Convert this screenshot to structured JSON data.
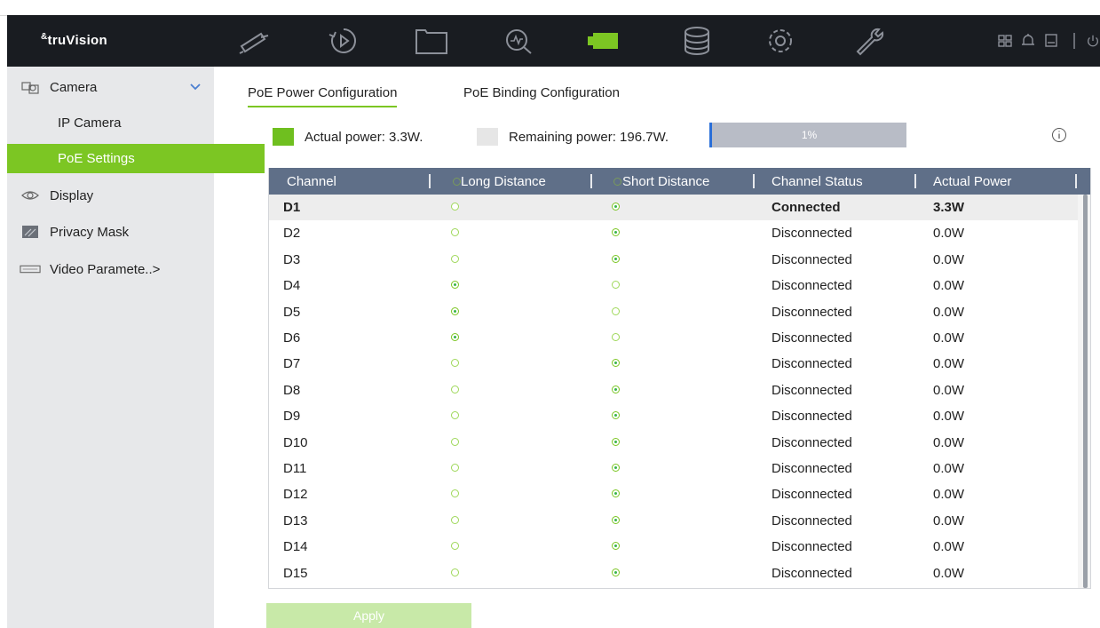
{
  "app": {
    "logo": "truVision",
    "logo_mark": "&"
  },
  "colors": {
    "accent": "#7cc623",
    "header_bg": "#191c21",
    "table_header": "#5f6f88"
  },
  "header": {
    "nav_icons": [
      "camera-icon",
      "playback-icon",
      "folder-icon",
      "search-event-icon",
      "video-camera-icon",
      "storage-icon",
      "settings-icon",
      "maintenance-icon"
    ],
    "active_nav": "video-camera-icon",
    "right_icons": [
      "grid-icon",
      "bell-icon",
      "monitor-icon",
      "power-icon"
    ]
  },
  "sidebar": {
    "items": [
      {
        "label": "Camera",
        "icon": "camera-icon",
        "expanded": true
      },
      {
        "label": "IP Camera"
      },
      {
        "label": "PoE Settings",
        "active": true
      },
      {
        "label": "Display",
        "icon": "eye-icon"
      },
      {
        "label": "Privacy Mask",
        "icon": "privacy-mask-icon"
      },
      {
        "label": "Video Paramete..>",
        "icon": "video-parameters-icon"
      }
    ]
  },
  "tabs": [
    {
      "label": "PoE Power Configuration",
      "selected": true
    },
    {
      "label": "PoE Binding Configuration",
      "selected": false
    }
  ],
  "power": {
    "actual_label": "Actual power: 3.3W.",
    "remaining_label": "Remaining power: 196.7W.",
    "usage_percent_text": "1%",
    "usage_fraction": 0.01,
    "actual_color": "#6fbf1f",
    "remaining_color": "#e6e6e6"
  },
  "table": {
    "headers": [
      "Channel",
      "Long Distance",
      "Short Distance",
      "Channel Status",
      "Actual Power"
    ],
    "rows": [
      {
        "channel": "D1",
        "long": false,
        "short": true,
        "status": "Connected",
        "power": "3.3W"
      },
      {
        "channel": "D2",
        "long": false,
        "short": true,
        "status": "Disconnected",
        "power": "0.0W"
      },
      {
        "channel": "D3",
        "long": false,
        "short": true,
        "status": "Disconnected",
        "power": "0.0W"
      },
      {
        "channel": "D4",
        "long": true,
        "short": false,
        "status": "Disconnected",
        "power": "0.0W"
      },
      {
        "channel": "D5",
        "long": true,
        "short": false,
        "status": "Disconnected",
        "power": "0.0W"
      },
      {
        "channel": "D6",
        "long": true,
        "short": false,
        "status": "Disconnected",
        "power": "0.0W"
      },
      {
        "channel": "D7",
        "long": false,
        "short": true,
        "status": "Disconnected",
        "power": "0.0W"
      },
      {
        "channel": "D8",
        "long": false,
        "short": true,
        "status": "Disconnected",
        "power": "0.0W"
      },
      {
        "channel": "D9",
        "long": false,
        "short": true,
        "status": "Disconnected",
        "power": "0.0W"
      },
      {
        "channel": "D10",
        "long": false,
        "short": true,
        "status": "Disconnected",
        "power": "0.0W"
      },
      {
        "channel": "D11",
        "long": false,
        "short": true,
        "status": "Disconnected",
        "power": "0.0W"
      },
      {
        "channel": "D12",
        "long": false,
        "short": true,
        "status": "Disconnected",
        "power": "0.0W"
      },
      {
        "channel": "D13",
        "long": false,
        "short": true,
        "status": "Disconnected",
        "power": "0.0W"
      },
      {
        "channel": "D14",
        "long": false,
        "short": true,
        "status": "Disconnected",
        "power": "0.0W"
      },
      {
        "channel": "D15",
        "long": false,
        "short": true,
        "status": "Disconnected",
        "power": "0.0W"
      }
    ]
  },
  "apply_label": "Apply"
}
